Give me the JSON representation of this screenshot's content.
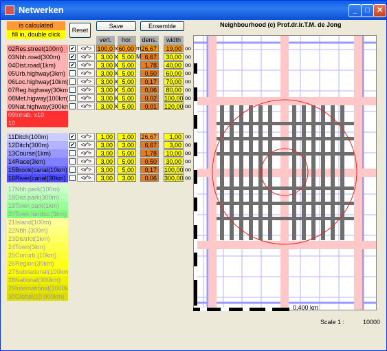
{
  "window": {
    "title": "Netwerken"
  },
  "legend": {
    "calculated": "is calculated",
    "fill": "fill in, double click"
  },
  "buttons": {
    "reset": "Reset",
    "save": "Save",
    "ensemble": "Ensemble"
  },
  "headers": {
    "vert": "vert.",
    "hor": "hor.",
    "dens": "dens.",
    "width": "width"
  },
  "map": {
    "title": "Neighbourhood (c) Prof.dr.ir.T.M. de Jong",
    "scale_length": "0,400 km",
    "scale_label": "Scale 1 :",
    "scale_value": "10000"
  },
  "group1": [
    {
      "label": "02Res.street(100m)",
      "bg": "#ff9999",
      "checked": "✔",
      "vert": "100,0",
      "hor": "60,00",
      "dens": "26,67",
      "width": "19,00",
      "vu": "x",
      "hu": "m",
      "vbg": "#ff9900",
      "hbg": "#ff9900",
      "dbg": "#ff9900",
      "wbg": "#ff9900"
    },
    {
      "label": "03Nbh.road(300m)",
      "bg": "#ffb3b3",
      "checked": "✔",
      "vert": "3,00",
      "hor": "5,00",
      "dens": "6,67",
      "width": "30,00",
      "vu": "x",
      "hu": "M",
      "vbg": "#ffff00",
      "hbg": "#ffff00",
      "dbg": "#e87c1a",
      "wbg": "#ffff00"
    },
    {
      "label": "04Dist.road(1km)",
      "bg": "#ffb3b3",
      "checked": "✔",
      "vert": "3,00",
      "hor": "5,00",
      "dens": "1,78",
      "width": "40,00",
      "vu": "x",
      "hu": "",
      "vbg": "#ffff00",
      "hbg": "#ffff00",
      "dbg": "#e87c1a",
      "wbg": "#ffff00"
    },
    {
      "label": "05Urb.highway(3km)",
      "bg": "#ffb3b3",
      "checked": "",
      "vert": "3,00",
      "hor": "5,00",
      "dens": "0,50",
      "width": "60,00",
      "vu": "x",
      "hu": "",
      "vbg": "#ffff00",
      "hbg": "#ffff00",
      "dbg": "#e87c1a",
      "wbg": "#ffff00"
    },
    {
      "label": "06Loc.highway(10km)",
      "bg": "#ffb3b3",
      "checked": "",
      "vert": "3,00",
      "hor": "5,00",
      "dens": "0,17",
      "width": "70,00",
      "vu": "x",
      "hu": "",
      "vbg": "#ffff00",
      "hbg": "#ffff00",
      "dbg": "#e87c1a",
      "wbg": "#ffff00"
    },
    {
      "label": "07Reg.highway(30km)",
      "bg": "#ffb3b3",
      "checked": "",
      "vert": "3,00",
      "hor": "5,00",
      "dens": "0,06",
      "width": "80,00",
      "vu": "x",
      "hu": "",
      "vbg": "#ffff00",
      "hbg": "#ffff00",
      "dbg": "#e87c1a",
      "wbg": "#ffff00"
    },
    {
      "label": "08Met.higway(100km)",
      "bg": "#ffb3b3",
      "checked": "",
      "vert": "3,00",
      "hor": "5,00",
      "dens": "0,02",
      "width": "100,00",
      "vu": "x",
      "hu": "",
      "vbg": "#ffff00",
      "hbg": "#ffff00",
      "dbg": "#e87c1a",
      "wbg": "#ffff00"
    },
    {
      "label": "09Nat.highway(300km)",
      "bg": "#ffb3b3",
      "checked": "",
      "vert": "3,00",
      "hor": "5,00",
      "dens": "0,01",
      "width": "120,00",
      "vu": "x",
      "hu": "",
      "vbg": "#ffff00",
      "hbg": "#ffff00",
      "dbg": "#e87c1a",
      "wbg": "#ffff00"
    }
  ],
  "inhab": [
    {
      "label": "09Inhab. x10",
      "bg": "#ff3030"
    },
    {
      "label": "10",
      "bg": "#ff3030"
    }
  ],
  "group2": [
    {
      "label": "11Ditch(100m)",
      "bg": "#ccccff",
      "checked": "✔",
      "vert": "1,00",
      "hor": "1,00",
      "dens": "26,67",
      "width": "1,00",
      "vbg": "#ffff00",
      "hbg": "#ffff00",
      "dbg": "#ff9933",
      "wbg": "#ffff00"
    },
    {
      "label": "12Ditch(300m)",
      "bg": "#b3b3ff",
      "checked": "✔",
      "vert": "3,00",
      "hor": "3,00",
      "dens": "6,67",
      "width": "3,00",
      "vbg": "#ffff00",
      "hbg": "#ffff00",
      "dbg": "#e87c1a",
      "wbg": "#ffff00"
    },
    {
      "label": "13Course(1km)",
      "bg": "#9999ff",
      "checked": "",
      "vert": "3,00",
      "hor": "5,00",
      "dens": "1,78",
      "width": "10,00",
      "vbg": "#ffff00",
      "hbg": "#ffff00",
      "dbg": "#e87c1a",
      "wbg": "#ffff00"
    },
    {
      "label": "14Race(3km)",
      "bg": "#8080ff",
      "checked": "",
      "vert": "3,00",
      "hor": "5,00",
      "dens": "0,50",
      "width": "30,00",
      "vbg": "#ffff00",
      "hbg": "#ffff00",
      "dbg": "#e87c1a",
      "wbg": "#ffff00"
    },
    {
      "label": "15Brook(canal(10km)",
      "bg": "#6666ff",
      "checked": "",
      "vert": "3,00",
      "hor": "5,00",
      "dens": "0,17",
      "width": "100,00",
      "vbg": "#ffff00",
      "hbg": "#ffff00",
      "dbg": "#e87c1a",
      "wbg": "#ffff00"
    },
    {
      "label": "16River(canal(30km)",
      "bg": "#4d4dff",
      "checked": "",
      "vert": "3,00",
      "hor": "3,00",
      "dens": "0,06",
      "width": "300,00",
      "vbg": "#ffff00",
      "hbg": "#ffff00",
      "dbg": "#e87c1a",
      "wbg": "#ffff00"
    }
  ],
  "green": [
    {
      "label": "17Nbh.park(100m)",
      "bg": "#ccffcc"
    },
    {
      "label": "18Dist.park(300m)",
      "bg": "#b3ffb3"
    },
    {
      "label": "19Town park(1km)",
      "bg": "#99ff99"
    },
    {
      "label": "20Town landsc.(3km)",
      "bg": "#80ff80"
    }
  ],
  "yellow": [
    {
      "label": "21Island(100m)",
      "bg": "#ffff99"
    },
    {
      "label": "22Nbh.(300m)",
      "bg": "#ffff80"
    },
    {
      "label": "23District(1km)",
      "bg": "#ffff66"
    },
    {
      "label": "24Town(3km)",
      "bg": "#ffff4d"
    },
    {
      "label": "25Conurb.(10km)",
      "bg": "#ffff33"
    },
    {
      "label": "26Region(30km)",
      "bg": "#ffff1a"
    },
    {
      "label": "27Subnational(100km)",
      "bg": "#ffff00"
    },
    {
      "label": "28National(300km)",
      "bg": "#f0f000"
    },
    {
      "label": "29International(1000km)",
      "bg": "#e6e600"
    },
    {
      "label": "30Global(10.000km)",
      "bg": "#dddd00"
    }
  ]
}
